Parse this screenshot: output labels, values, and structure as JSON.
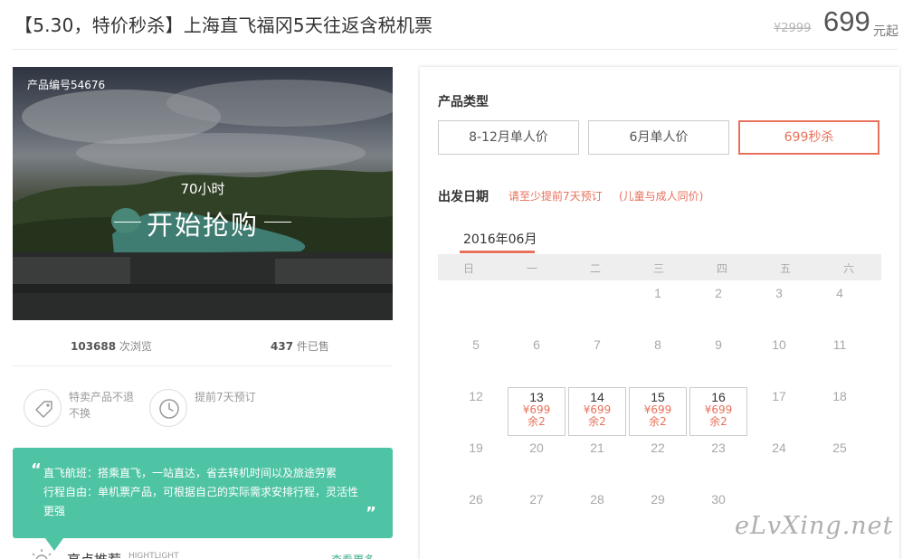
{
  "header": {
    "title": "【5.30，特价秒杀】上海直飞福冈5天往返含税机票",
    "old_price": "¥2999",
    "price": "699",
    "price_unit": "元起"
  },
  "hero": {
    "product_code": "产品编号54676",
    "countdown": "70小时",
    "cta": "开始抢购"
  },
  "stats": {
    "views_num": "103688",
    "views_label": " 次浏览",
    "sold_num": "437",
    "sold_label": " 件已售"
  },
  "policies": [
    {
      "icon": "tag-icon",
      "text": "特卖产品不退不换"
    },
    {
      "icon": "clock-icon",
      "text": "提前7天预订"
    }
  ],
  "quote": {
    "lines": [
      "直飞航班：搭乘直飞，一站直达，省去转机时间以及旅途劳累",
      "行程自由：单机票产品，可根据自己的实际需求安排行程，灵活性",
      "更强"
    ]
  },
  "highlight": {
    "title": "亮点推荐",
    "en": "HIGHTLIGHT",
    "more": "查看更多"
  },
  "product_type": {
    "label": "产品类型",
    "options": [
      "8-12月单人价",
      "6月单人价",
      "699秒杀"
    ],
    "selected": 2
  },
  "departure": {
    "label": "出发日期",
    "notice_1": "请至少提前7天预订",
    "notice_2": "(儿童与成人同价)"
  },
  "calendar": {
    "month": "2016年06月",
    "weekdays": [
      "日",
      "一",
      "二",
      "三",
      "四",
      "五",
      "六"
    ],
    "first_weekday": 3,
    "days_in_month": 30,
    "available": [
      {
        "day": 13,
        "price": "¥699",
        "left": "余2"
      },
      {
        "day": 14,
        "price": "¥699",
        "left": "余2"
      },
      {
        "day": 15,
        "price": "¥699",
        "left": "余2"
      },
      {
        "day": 16,
        "price": "¥699",
        "left": "余2"
      }
    ]
  },
  "watermark": "eLvXing.net",
  "colors": {
    "accent": "#e8715c",
    "green": "#4fc4a4"
  }
}
